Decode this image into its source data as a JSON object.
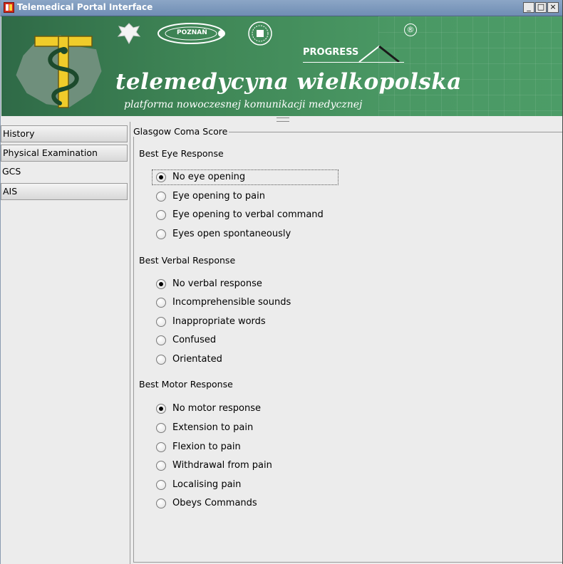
{
  "window": {
    "title": "Telemedical Portal Interface",
    "buttons": {
      "minimize": "_",
      "maximize": "□",
      "close": "×"
    }
  },
  "banner": {
    "title": "telemedycyna wielkopolska",
    "subtitle": "platforma nowoczesnej komunikacji medycznej",
    "poznan_badge": "POZNAŃ",
    "progress_logo": "PROGRESS",
    "registered": "®",
    "colors": {
      "bg_dark": "#2f6a47",
      "bg_light": "#4c9c67",
      "logo_yellow": "#f0cc2a"
    }
  },
  "sidebar": {
    "items": [
      {
        "label": "History",
        "selected": false
      },
      {
        "label": "Physical Examination",
        "selected": false
      },
      {
        "label": "GCS",
        "selected": true
      },
      {
        "label": "AIS",
        "selected": false
      }
    ]
  },
  "gcs": {
    "group_title": "Glasgow Coma Score",
    "eye": {
      "label": "Best Eye Response",
      "selected": 0,
      "options": [
        "No eye opening",
        "Eye opening to pain",
        "Eye opening to verbal command",
        "Eyes open spontaneously"
      ]
    },
    "verbal": {
      "label": "Best Verbal Response",
      "selected": 0,
      "options": [
        "No verbal response",
        "Incomprehensible sounds",
        "Inappropriate words",
        "Confused",
        "Orientated"
      ]
    },
    "motor": {
      "label": "Best Motor Response",
      "selected": 0,
      "options": [
        "No motor response",
        "Extension to pain",
        "Flexion to pain",
        "Withdrawal from pain",
        "Localising pain",
        "Obeys Commands"
      ]
    }
  }
}
